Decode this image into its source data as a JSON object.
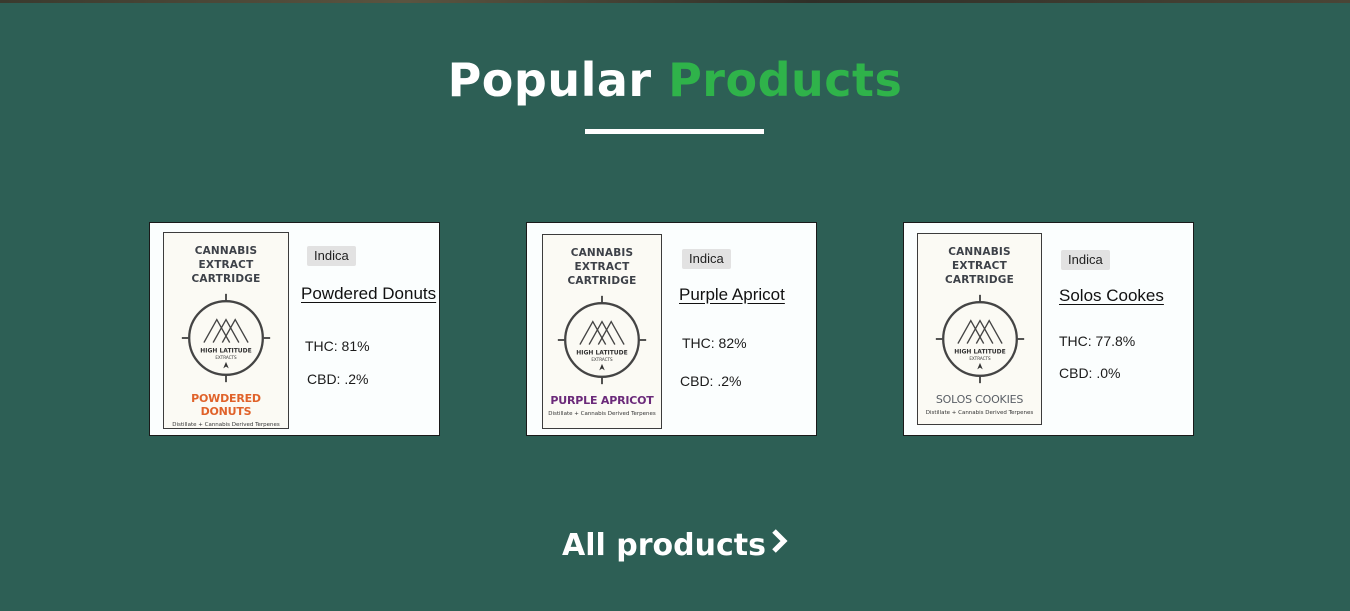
{
  "section": {
    "title_plain": "Popular",
    "title_accent": "Products"
  },
  "colors": {
    "background": "#2d5f55",
    "accent": "#2fb34a",
    "card": "#fbfefe"
  },
  "products": [
    {
      "pack_line1": "CANNABIS",
      "pack_line2": "EXTRACT CARTRIDGE",
      "pack_brand": "HIGH LATITUDE",
      "pack_brand_sub": "EXTRACTS",
      "pack_flavor": "POWDERED DONUTS",
      "pack_flavor_color": "#e0622a",
      "pack_footer": "Distillate + Cannabis Derived Terpenes",
      "type": "Indica",
      "name": "Powdered Donuts",
      "thc": "THC: 81%",
      "cbd": "CBD: .2%"
    },
    {
      "pack_line1": "CANNABIS",
      "pack_line2": "EXTRACT CARTRIDGE",
      "pack_brand": "HIGH LATITUDE",
      "pack_brand_sub": "EXTRACTS",
      "pack_flavor": "PURPLE APRICOT",
      "pack_flavor_color": "#6b2a7a",
      "pack_footer": "Distillate + Cannabis Derived Terpenes",
      "type": "Indica",
      "name": "Purple Apricot",
      "thc": "THC: 82%",
      "cbd": "CBD: .2%"
    },
    {
      "pack_line1": "CANNABIS",
      "pack_line2": "EXTRACT CARTRIDGE",
      "pack_brand": "HIGH LATITUDE",
      "pack_brand_sub": "EXTRACTS",
      "pack_flavor": "SOLOS COOKIES",
      "pack_flavor_color": "#5a5f66",
      "pack_footer": "Distillate + Cannabis Derived Terpenes",
      "type": "Indica",
      "name": "Solos Cookes",
      "thc": "THC: 77.8%",
      "cbd": "CBD: .0%"
    }
  ],
  "footer_link": {
    "label": "All products",
    "icon": "chevron-right-icon"
  }
}
